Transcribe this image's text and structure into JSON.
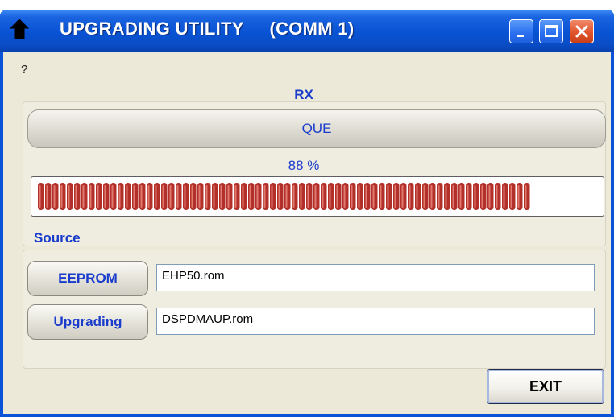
{
  "window": {
    "title": "UPGRADING UTILITY",
    "port": "(COMM 1)"
  },
  "menu": {
    "help": "?"
  },
  "rx": {
    "title": "RX",
    "status": "QUE",
    "percent_label": "88 %",
    "progress": 0.88
  },
  "source": {
    "title": "Source",
    "eeprom_button": "EEPROM",
    "eeprom_file": "EHP50.rom",
    "upgrading_button": "Upgrading",
    "upgrading_file": "DSPDMAUP.rom"
  },
  "exit_label": "EXIT",
  "colors": {
    "title_bar": "#0853d4",
    "label_blue": "#1a3ccc",
    "progress_segment": "#b3302a",
    "close_button": "#e2542c"
  },
  "icons": [
    "app-icon",
    "minimize-icon",
    "maximize-icon",
    "close-icon"
  ]
}
